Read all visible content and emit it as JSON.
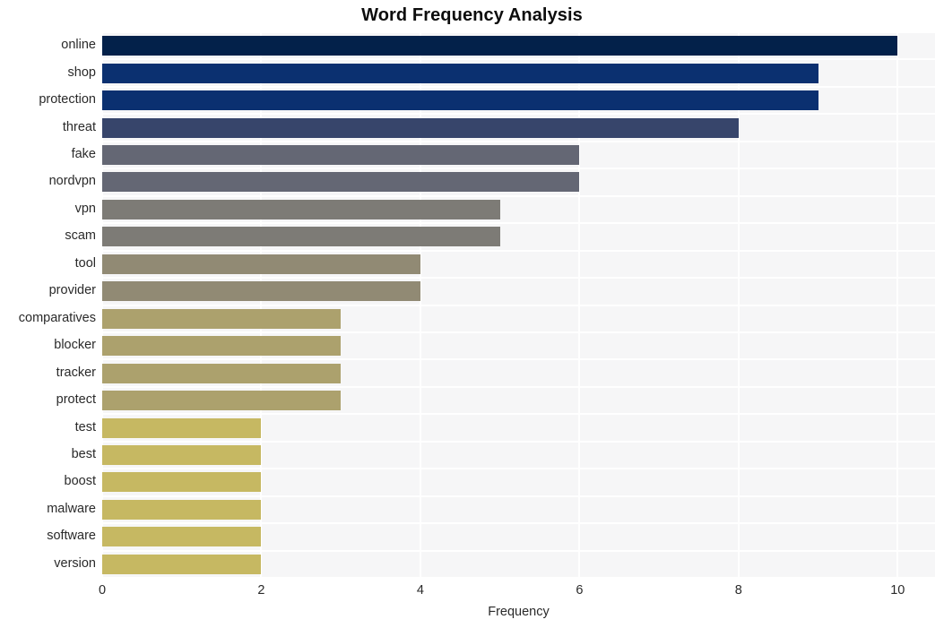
{
  "chart_data": {
    "type": "bar",
    "orientation": "horizontal",
    "title": "Word Frequency Analysis",
    "xlabel": "Frequency",
    "ylabel": "",
    "xlim": [
      0,
      10.47
    ],
    "ylim_categories": 20,
    "grid": true,
    "legend": null,
    "xticks": [
      "0",
      "2",
      "4",
      "6",
      "8",
      "10"
    ],
    "xtick_values": [
      0,
      2,
      4,
      6,
      8,
      10
    ],
    "categories": [
      "online",
      "shop",
      "protection",
      "threat",
      "fake",
      "nordvpn",
      "vpn",
      "scam",
      "tool",
      "provider",
      "comparatives",
      "blocker",
      "tracker",
      "protect",
      "test",
      "best",
      "boost",
      "malware",
      "software",
      "version"
    ],
    "values": [
      10,
      9,
      9,
      8,
      6,
      6,
      5,
      5,
      4,
      4,
      3,
      3,
      3,
      3,
      2,
      2,
      2,
      2,
      2,
      2
    ],
    "bar_colors": [
      "#03214a",
      "#0b3070",
      "#0b3070",
      "#37456b",
      "#646774",
      "#646774",
      "#7d7b76",
      "#7d7b76",
      "#918a74",
      "#918a74",
      "#aca16d",
      "#aca16d",
      "#aca16d",
      "#aca16d",
      "#c6b862",
      "#c6b862",
      "#c6b862",
      "#c6b862",
      "#c6b862",
      "#c6b862"
    ]
  },
  "style": {
    "plot_background": "#f6f6f7",
    "grid_color": "#ffffff",
    "figure_background": "#ffffff",
    "text_color": "#2a2a2a",
    "title_color": "#0d0d0d"
  }
}
